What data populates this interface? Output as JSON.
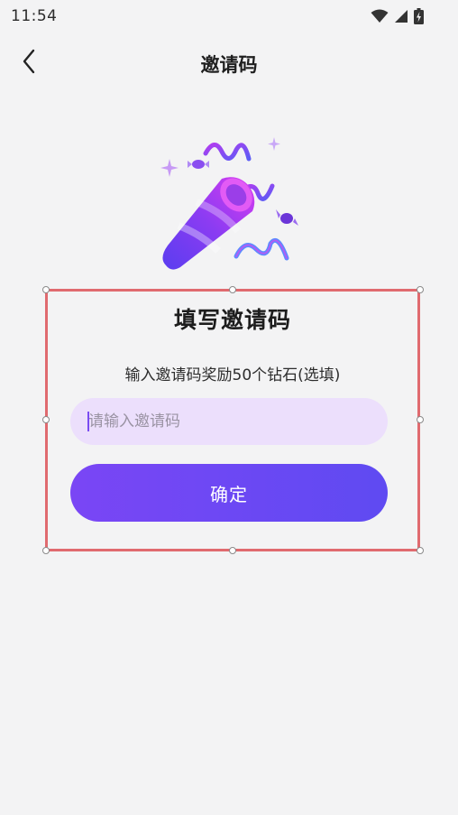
{
  "status_bar": {
    "time": "11:54",
    "icons": [
      "wifi-icon",
      "cellular-signal-icon",
      "battery-charging-icon"
    ]
  },
  "nav": {
    "title": "邀请码",
    "back_icon": "chevron-left-icon"
  },
  "illustration": {
    "icon": "party-popper-icon",
    "colors": {
      "primary": "#7a46f5",
      "secondary": "#c43df0",
      "accent": "#5b8cff"
    }
  },
  "card": {
    "title": "填写邀请码",
    "subtitle": "输入邀请码奖励50个钻石(选填)",
    "input": {
      "value": "",
      "placeholder": "请输入邀请码"
    },
    "confirm_label": "确定"
  },
  "theme": {
    "background": "#f3f3f4",
    "button_gradient_start": "#7a46f5",
    "button_gradient_end": "#5f4af2",
    "input_background": "#ecdffc",
    "selection_border": "#e06a6f"
  }
}
